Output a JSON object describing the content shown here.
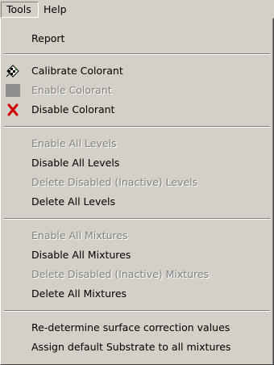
{
  "menubar": {
    "tools_label": "Tools",
    "help_label": "Help"
  },
  "menu": {
    "report": "Report",
    "calibrate_colorant": "Calibrate Colorant",
    "enable_colorant": "Enable Colorant",
    "disable_colorant": "Disable Colorant",
    "enable_all_levels": "Enable All Levels",
    "disable_all_levels": "Disable All Levels",
    "delete_disabled_levels": "Delete Disabled (Inactive) Levels",
    "delete_all_levels": "Delete All Levels",
    "enable_all_mixtures": "Enable All Mixtures",
    "disable_all_mixtures": "Disable All Mixtures",
    "delete_disabled_mixtures": "Delete Disabled (Inactive) Mixtures",
    "delete_all_mixtures": "Delete All Mixtures",
    "redetermine_surface": "Re-determine surface correction values",
    "assign_default_substrate": "Assign default Substrate to all mixtures"
  },
  "icons": {
    "calibrate": "checkered-flag-icon",
    "enable": "gray-square-icon",
    "disable": "red-x-icon"
  },
  "colors": {
    "menu_bg": "#d4d0c8",
    "disabled_text": "#808080",
    "disable_icon": "#cc0000"
  }
}
